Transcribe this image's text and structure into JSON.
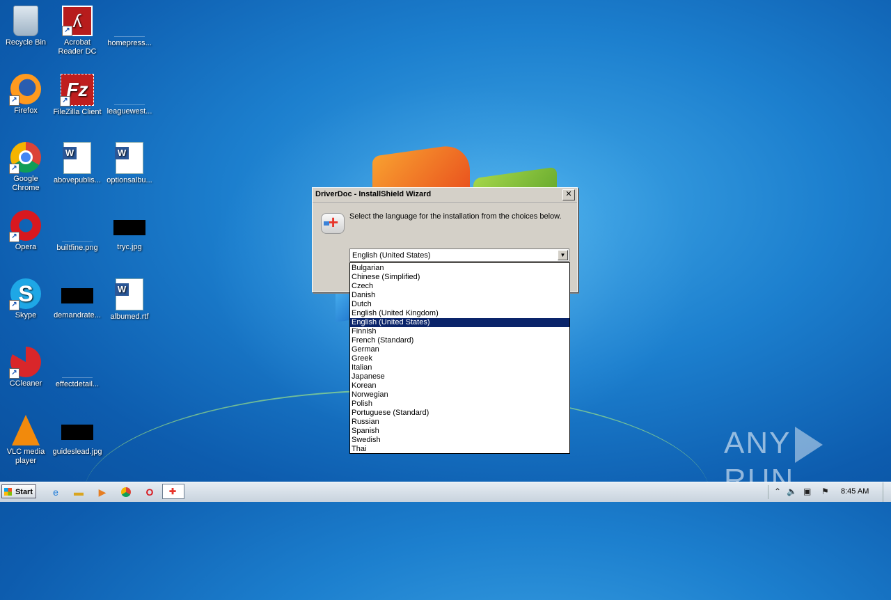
{
  "desktop": {
    "icons": [
      {
        "label": "Recycle Bin",
        "icon": "recycle-bin-icon"
      },
      {
        "label": "Acrobat Reader DC",
        "icon": "acrobat-icon"
      },
      {
        "label": "homepress...",
        "icon": "blank-file-icon"
      },
      {
        "label": "Firefox",
        "icon": "firefox-icon"
      },
      {
        "label": "FileZilla Client",
        "icon": "filezilla-icon"
      },
      {
        "label": "leaguewest...",
        "icon": "blank-file-icon"
      },
      {
        "label": "Google Chrome",
        "icon": "chrome-icon"
      },
      {
        "label": "abovepublis...",
        "icon": "word-doc-icon"
      },
      {
        "label": "optionsalbu...",
        "icon": "word-doc-icon"
      },
      {
        "label": "Opera",
        "icon": "opera-icon"
      },
      {
        "label": "builtfine.png",
        "icon": "image-file-icon"
      },
      {
        "label": "tryc.jpg",
        "icon": "image-file-icon"
      },
      {
        "label": "Skype",
        "icon": "skype-icon"
      },
      {
        "label": "demandrate...",
        "icon": "image-file-icon"
      },
      {
        "label": "albumed.rtf",
        "icon": "word-doc-icon"
      },
      {
        "label": "CCleaner",
        "icon": "ccleaner-icon"
      },
      {
        "label": "effectdetail...",
        "icon": "blank-file-icon"
      },
      {
        "label": "VLC media player",
        "icon": "vlc-icon"
      },
      {
        "label": "guideslead.jpg",
        "icon": "image-file-icon"
      }
    ]
  },
  "dialog": {
    "title": "DriverDoc - InstallShield Wizard",
    "close_label": "✕",
    "message": "Select the language for the installation from the choices below.",
    "selected_language": "English (United States)",
    "languages": [
      "Bulgarian",
      "Chinese (Simplified)",
      "Czech",
      "Danish",
      "Dutch",
      "English (United Kingdom)",
      "English (United States)",
      "Finnish",
      "French (Standard)",
      "German",
      "Greek",
      "Italian",
      "Japanese",
      "Korean",
      "Norwegian",
      "Polish",
      "Portuguese (Standard)",
      "Russian",
      "Spanish",
      "Swedish",
      "Thai"
    ]
  },
  "watermark": {
    "left": "ANY",
    "right": "RUN"
  },
  "taskbar": {
    "start_label": "Start",
    "clock": "8:45 AM"
  }
}
